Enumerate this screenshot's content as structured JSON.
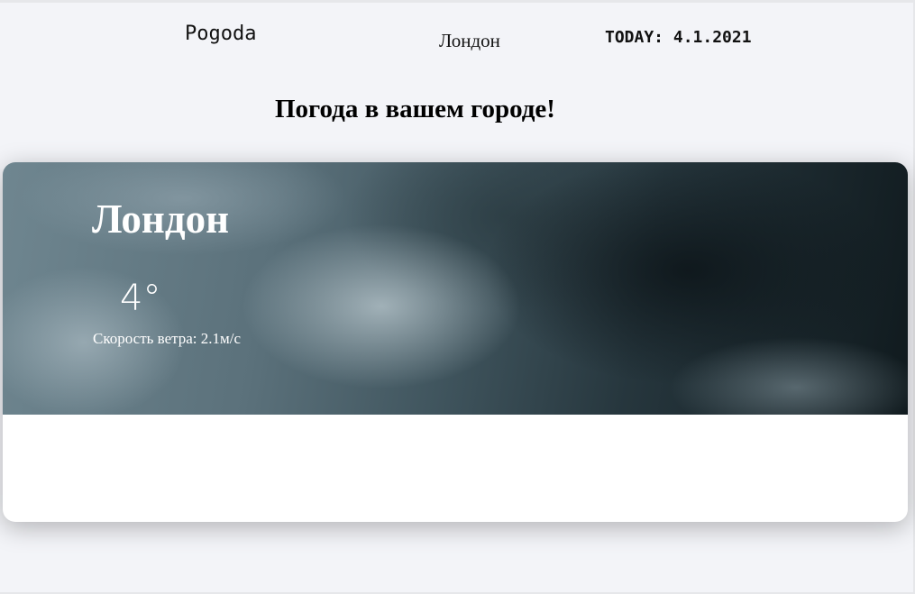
{
  "header": {
    "logo": "Pogoda",
    "city": "Лондон",
    "date": "TODAY: 4.1.2021"
  },
  "page": {
    "heading": "Погода в вашем городе!"
  },
  "weather_card": {
    "city": "Лондон",
    "temperature": "4°",
    "wind": "Скорость ветра: 2.1м/с"
  }
}
